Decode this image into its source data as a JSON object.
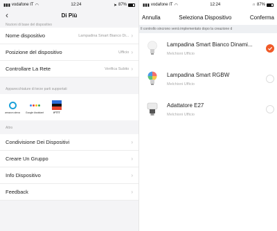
{
  "left": {
    "status": {
      "carrier": "vodafone IT",
      "time": "12:24",
      "battery": "87%"
    },
    "nav": {
      "title": "Di Più"
    },
    "basic_section_label": "Nozioni di base del dispositivo",
    "rows": [
      {
        "label": "Nome dispositivo",
        "value": "Lampadina Smart Bianco Di..."
      },
      {
        "label": "Posizione del dispositivo",
        "value": "Ufficio"
      },
      {
        "label": "Controllare La Rete",
        "value": "Verifica Subito"
      }
    ],
    "services_label": "Apparecchiature di terze parti supportati",
    "services": [
      {
        "caption": "amazon alexa",
        "icon": "alexa-icon"
      },
      {
        "caption": "Google Assistant",
        "icon": "google-assistant-icon"
      },
      {
        "caption": "IFTTT",
        "icon": "ifttt-icon"
      }
    ],
    "other_label": "Altro",
    "other_rows": [
      {
        "label": "Condivisione Dei Dispositivi"
      },
      {
        "label": "Creare Un Gruppo"
      },
      {
        "label": "Info Dispositivo"
      },
      {
        "label": "Feedback"
      }
    ]
  },
  "right": {
    "status": {
      "carrier": "vodafone IT",
      "time": "12:24",
      "battery": "87%"
    },
    "nav": {
      "cancel": "Annulla",
      "title": "Seleziona Dispositivo",
      "confirm": "Conferma"
    },
    "notice": "Il controllo sincrono verrà implementato dopo la creazione d",
    "devices": [
      {
        "name": "Lampadina Smart Bianco Dinami...",
        "room": "Melchioni Ufficio",
        "selected": true,
        "icon": "white-bulb-icon"
      },
      {
        "name": "Lampadina Smart RGBW",
        "room": "Melchioni Ufficio",
        "selected": false,
        "icon": "rgb-bulb-icon"
      },
      {
        "name": "Adattatore E27",
        "room": "Melchioni Ufficio",
        "selected": false,
        "icon": "e27-adapter-icon"
      }
    ]
  },
  "colors": {
    "accent": "#f05a28",
    "alexa": "#1aa1d9"
  }
}
